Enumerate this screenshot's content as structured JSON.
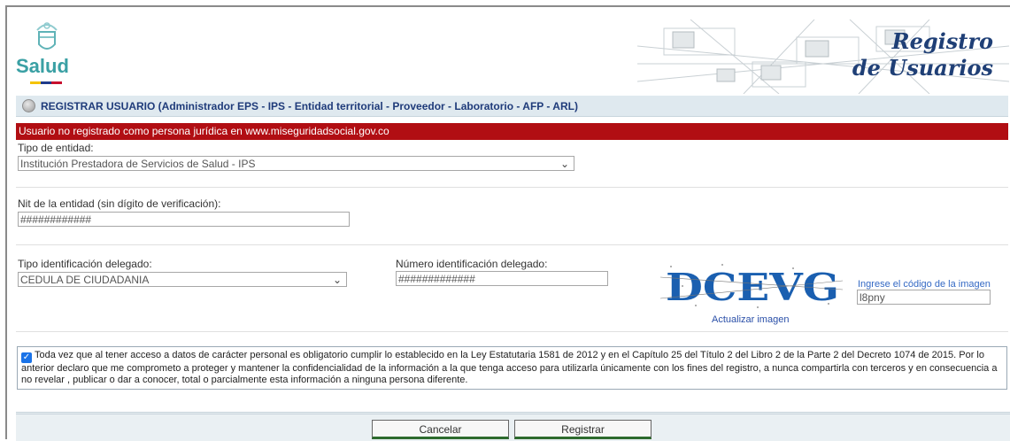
{
  "header": {
    "logo_text": "Salud",
    "banner_line1": "Registro",
    "banner_line2": "de Usuarios"
  },
  "title": "REGISTRAR USUARIO (Administrador EPS - IPS - Entidad territorial - Proveedor - Laboratorio - AFP - ARL)",
  "error_message": "Usuario no registrado como persona jurídica en www.miseguridadsocial.gov.co",
  "form": {
    "entity_type_label": "Tipo de entidad:",
    "entity_type_value": "Institución Prestadora de Servicios de Salud - IPS",
    "nit_label": "Nit de la entidad (sin dígito de verificación):",
    "nit_value": "############",
    "delegate_id_type_label": "Tipo identificación delegado:",
    "delegate_id_type_value": "CEDULA DE CIUDADANIA",
    "delegate_id_number_label": "Número identificación delegado:",
    "delegate_id_number_value": "#############",
    "captcha_text": "DCEVG",
    "captcha_refresh": "Actualizar imagen",
    "captcha_prompt": "Ingrese el código de la imagen",
    "captcha_value": "l8pny"
  },
  "terms": {
    "checked": true,
    "text": "Toda vez que al tener acceso a datos de carácter personal es obligatorio cumplir lo establecido en la Ley Estatutaria 1581 de 2012 y en el Capítulo 25 del Título 2 del Libro 2 de la Parte 2 del Decreto 1074 de 2015. Por lo anterior declaro que me comprometo a proteger y mantener la confidencialidad de la información a la que tenga acceso para utilizarla únicamente con los fines del registro, a nunca compartirla con terceros y en consecuencia a no revelar , publicar o dar a conocer, total o parcialmente esta información a ninguna persona diferente."
  },
  "buttons": {
    "cancel": "Cancelar",
    "register": "Registrar"
  },
  "colors": {
    "error_bg": "#b10e13",
    "title_text": "#1f3b7a",
    "banner_text": "#1f3f76",
    "logo_teal": "#3aa0a4"
  }
}
